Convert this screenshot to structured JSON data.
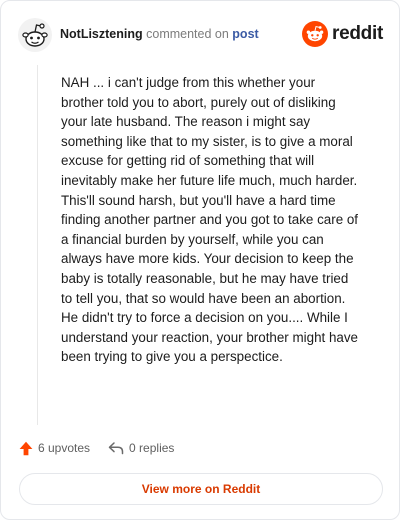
{
  "header": {
    "username": "NotLisztening",
    "action_text": "commented on",
    "target_text": "post",
    "brand_name": "reddit",
    "brand_color": "#ff4500"
  },
  "comment": {
    "text": "NAH ... i can't judge from this whether your brother told you to abort, purely out of disliking your late husband. The reason i might say something like that to my sister, is to give a moral excuse for getting rid of something that will inevitably make her future life much, much harder. This'll sound harsh, but you'll have a hard time finding another partner and you got to take care of a financial burden by yourself, while you can always have more kids. Your decision to keep the baby is totally reasonable, but he may have tried to tell you, that so would have been an abortion. He didn't try to force a decision on you.... While I understand your reaction, your brother might have been trying to give you a perspectice."
  },
  "footer": {
    "upvotes_label": "6 upvotes",
    "replies_label": "0 replies",
    "upvote_icon": "upvote-arrow-icon",
    "reply_icon": "reply-arrow-icon",
    "upvote_color": "#ff4500"
  },
  "cta": {
    "label": "View more on Reddit",
    "color": "#d93a00"
  }
}
